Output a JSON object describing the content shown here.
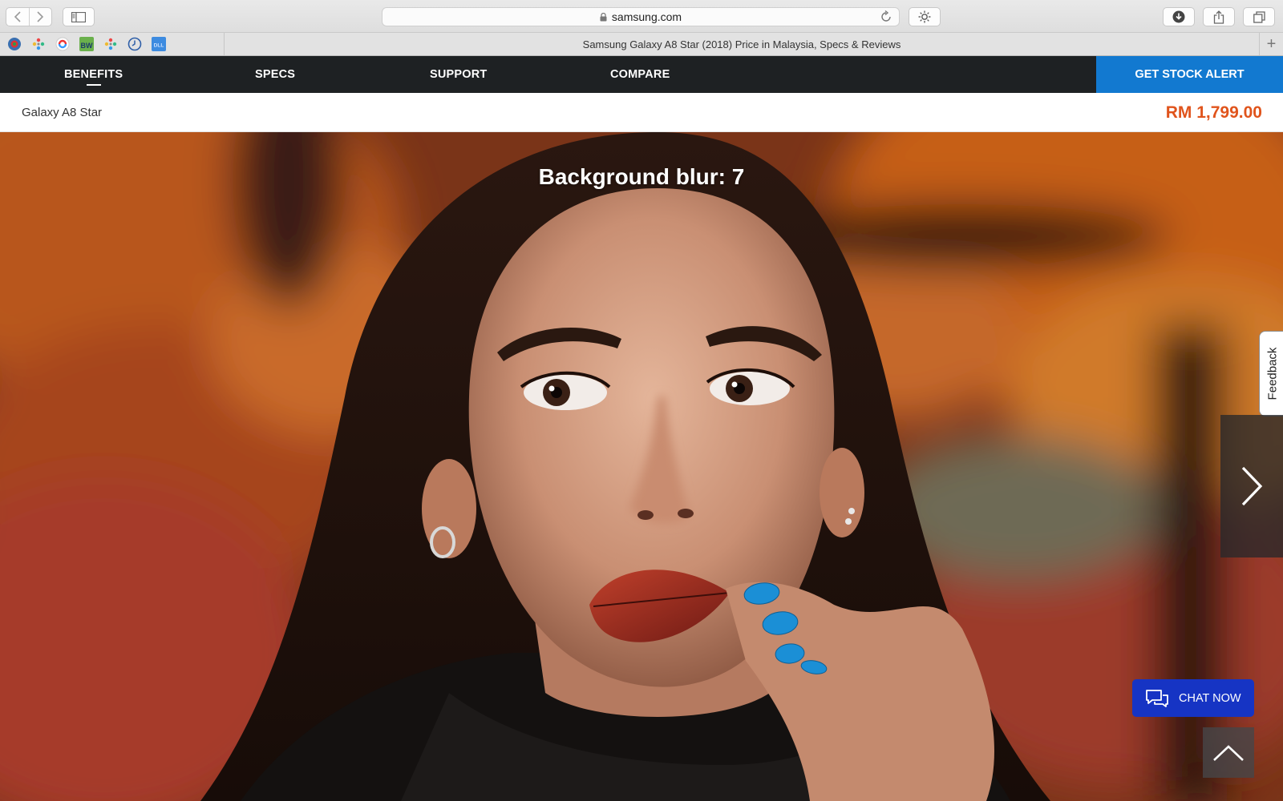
{
  "browser": {
    "url": "samsung.com",
    "tab_title": "Samsung Galaxy A8 Star (2018) Price in Malaysia, Specs & Reviews",
    "bookmark_icons": [
      "wikipedia-icon",
      "pinwheel-icon",
      "red-circle-icon",
      "bw-icon",
      "pinwheel-icon",
      "clock-icon",
      "dll-icon"
    ],
    "bookmark_labels": {
      "bw": "BW",
      "dll": "DLL"
    }
  },
  "nav": {
    "items": [
      {
        "label": "BENEFITS",
        "active": true
      },
      {
        "label": "SPECS",
        "active": false
      },
      {
        "label": "SUPPORT",
        "active": false
      },
      {
        "label": "COMPARE",
        "active": false
      }
    ],
    "cta_label": "GET STOCK ALERT"
  },
  "product": {
    "name": "Galaxy A8 Star",
    "price": "RM 1,799.00"
  },
  "hero": {
    "caption": "Background blur: 7"
  },
  "widgets": {
    "feedback_label": "Feedback",
    "chat_label": "CHAT NOW"
  },
  "colors": {
    "nav_bg": "#1e2123",
    "cta_bg": "#1279d0",
    "price": "#e0541c",
    "chat_bg": "#1634c4"
  }
}
